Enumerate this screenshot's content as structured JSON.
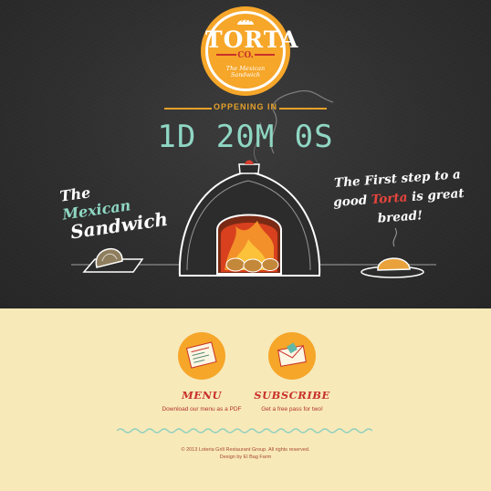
{
  "logo": {
    "title": "TORTA",
    "co": "CO.",
    "tagline1": "The Mexican",
    "tagline2": "Sandwich",
    "icon": "bread-icon"
  },
  "countdown": {
    "label": "OPPENING IN",
    "value": "1D 20M 0S"
  },
  "left_caption": {
    "word1": "The",
    "word2": "Mexican",
    "word3": "Sandwich"
  },
  "right_caption": {
    "line1": "The First step to a",
    "part1": "good",
    "highlight": "Torta",
    "part2": "is great bread!"
  },
  "features": [
    {
      "title": "MENU",
      "subtitle": "Download our menu as a PDF",
      "icon": "menu-document-icon"
    },
    {
      "title": "SUBSCRIBE",
      "subtitle": "Get a free pass for two!",
      "icon": "envelope-icon"
    }
  ],
  "footer": {
    "copyright": "© 2013 Loteria Grill Restaurant Group. All rights reserved.",
    "credit": "Design by El Bag Farm"
  },
  "colors": {
    "chalkboard": "#2e2e2e",
    "cream": "#f8e9b9",
    "orange": "#f6a629",
    "red": "#c8312a",
    "mint": "#8fd7c3"
  }
}
